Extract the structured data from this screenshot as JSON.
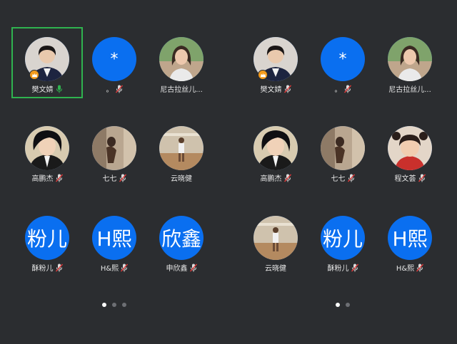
{
  "left_panel": {
    "tiles": [
      {
        "name": "樊文婧",
        "avatar_type": "photo",
        "mic": "on",
        "host": true,
        "active": true
      },
      {
        "name": "。",
        "avatar_type": "text",
        "avatar_text": "*",
        "mic": "muted"
      },
      {
        "name": "尼古拉丝儿...",
        "avatar_type": "photo",
        "mic": "none"
      },
      {
        "name": "高鹏杰",
        "avatar_type": "photo",
        "mic": "muted"
      },
      {
        "name": "七七",
        "avatar_type": "photo",
        "mic": "muted"
      },
      {
        "name": "云晓健",
        "avatar_type": "photo",
        "mic": "none"
      },
      {
        "name": "酥粉儿",
        "avatar_type": "text",
        "avatar_text": "粉儿",
        "mic": "muted"
      },
      {
        "name": "H&熙",
        "avatar_type": "text",
        "avatar_text": "H熙",
        "mic": "muted"
      },
      {
        "name": "申欣鑫",
        "avatar_type": "text",
        "avatar_text": "欣鑫",
        "mic": "muted"
      }
    ],
    "page_dots": 3,
    "active_dot": 0
  },
  "right_panel": {
    "tiles": [
      {
        "name": "樊文婧",
        "avatar_type": "photo",
        "mic": "muted",
        "host": true
      },
      {
        "name": "。",
        "avatar_type": "text",
        "avatar_text": "*",
        "mic": "muted"
      },
      {
        "name": "尼古拉丝儿...",
        "avatar_type": "photo",
        "mic": "none"
      },
      {
        "name": "高鹏杰",
        "avatar_type": "photo",
        "mic": "muted"
      },
      {
        "name": "七七",
        "avatar_type": "photo",
        "mic": "muted"
      },
      {
        "name": "程文荟",
        "avatar_type": "photo",
        "mic": "muted"
      },
      {
        "name": "云晓健",
        "avatar_type": "photo",
        "mic": "none"
      },
      {
        "name": "酥粉儿",
        "avatar_type": "text",
        "avatar_text": "粉儿",
        "mic": "muted"
      },
      {
        "name": "H&熙",
        "avatar_type": "text",
        "avatar_text": "H熙",
        "mic": "muted"
      }
    ],
    "page_dots": 2,
    "active_dot": 0
  },
  "colors": {
    "background": "#2b2d30",
    "text_avatar": "#0a6ff0",
    "active_border": "#2fb34f",
    "mic_on": "#2fb34f",
    "mic_muted": "#e23b3b",
    "host_badge": "#f39a1c"
  },
  "icons": {
    "mic_on": "mic-icon",
    "mic_muted": "mic-muted-icon",
    "host": "host-crown-icon"
  }
}
